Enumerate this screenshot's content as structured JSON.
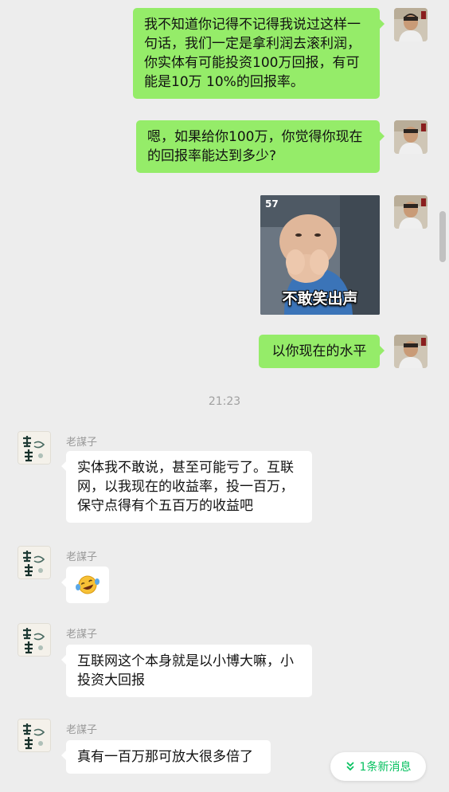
{
  "messages": {
    "me1": "我不知道你记得不记得我说过这样一句话，我们一定是拿利润去滚利润，你实体有可能投资100万回报，有可能是10万 10%的回报率。",
    "me2": "嗯，如果给你100万，你觉得你现在的回报率能达到多少?",
    "sticker_number": "57",
    "sticker_caption": "不敢笑出声",
    "me3": "以你现在的水平",
    "time": "21:23",
    "other_name": "老謀子",
    "other1": "实体我不敢说，甚至可能亏了。互联网，以我现在的收益率，投一百万，保守点得有个五百万的收益吧",
    "other3": "互联网这个本身就是以小博大嘛，小投资大回报",
    "other4": "真有一百万那可放大很多倍了"
  },
  "new_message_button": "1条新消息",
  "colors": {
    "my_bubble": "#95ec69",
    "other_bubble": "#ffffff",
    "background": "#ededed",
    "new_message_text": "#07c160"
  }
}
